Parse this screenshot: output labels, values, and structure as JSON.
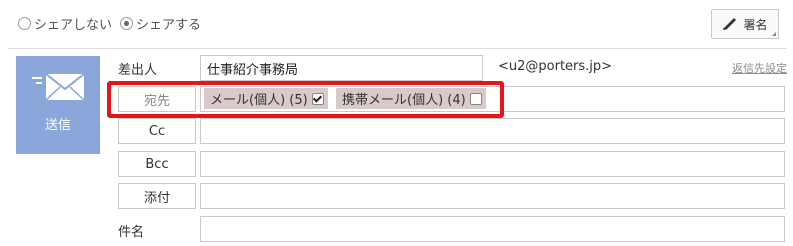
{
  "share": {
    "no_share_label": "シェアしない",
    "share_label": "シェアする",
    "selected": "share"
  },
  "toolbar": {
    "signature_label": "署名",
    "signature_icon": "pen-icon"
  },
  "send": {
    "label": "送信",
    "icon": "envelope-icon",
    "color": "#8aa6db"
  },
  "sender": {
    "label": "差出人",
    "value": "仕事紹介事務局",
    "email": "<u2@porters.jp>",
    "reply_to_link": "返信先設定"
  },
  "to": {
    "label": "宛先",
    "chips": [
      {
        "label": "メール(個人) (5)",
        "checked": true
      },
      {
        "label": "携帯メール(個人) (4)",
        "checked": false
      }
    ]
  },
  "cc": {
    "label": "Cc",
    "value": ""
  },
  "bcc": {
    "label": "Bcc",
    "value": ""
  },
  "attach": {
    "label": "添付"
  },
  "subject": {
    "label": "件名",
    "value": ""
  },
  "colors": {
    "highlight": "#e4151b",
    "chip_bg": "#d9c9c9"
  }
}
